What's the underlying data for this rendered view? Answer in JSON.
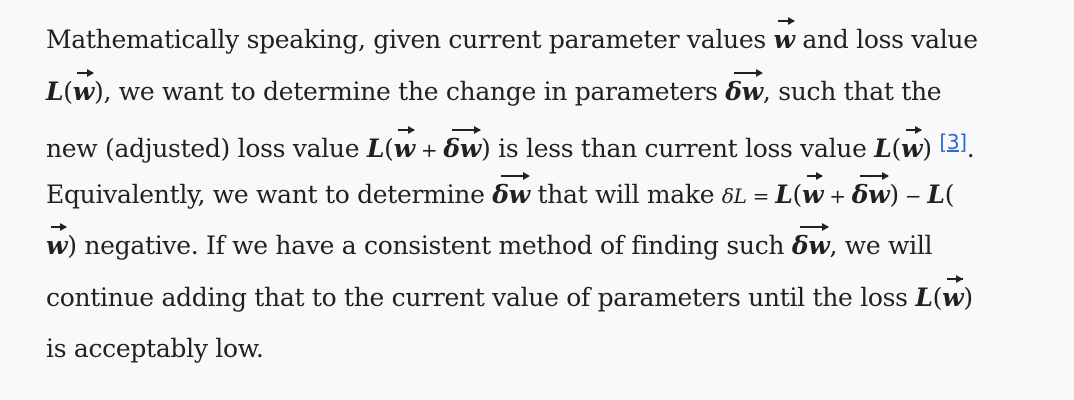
{
  "paragraph": {
    "l1_a": "Mathematically speaking, given current parameter values ",
    "w": "w",
    "l1_b": " and loss value",
    "L": "L",
    "lp": "(",
    "rp": ")",
    "l2_a": ", we want to determine the change in parameters ",
    "dw": "δw",
    "l2_b": ", such that the",
    "l3_a": "new (adjusted) loss value ",
    "plus": " + ",
    "l3_b": " is less than current loss value ",
    "ref": "[3]",
    "l3_c": ".",
    "l4_a": "Equivalently, we want to determine ",
    "l4_b": " that will make ",
    "deltaL": "δL",
    "eq": " = ",
    "minus": " − ",
    "l5_b": " negative. If we have a consistent method of finding such ",
    "l5_c": ", we will",
    "l6_a": "continue adding that to the current value of parameters until the loss ",
    "l7": "is acceptably low."
  }
}
